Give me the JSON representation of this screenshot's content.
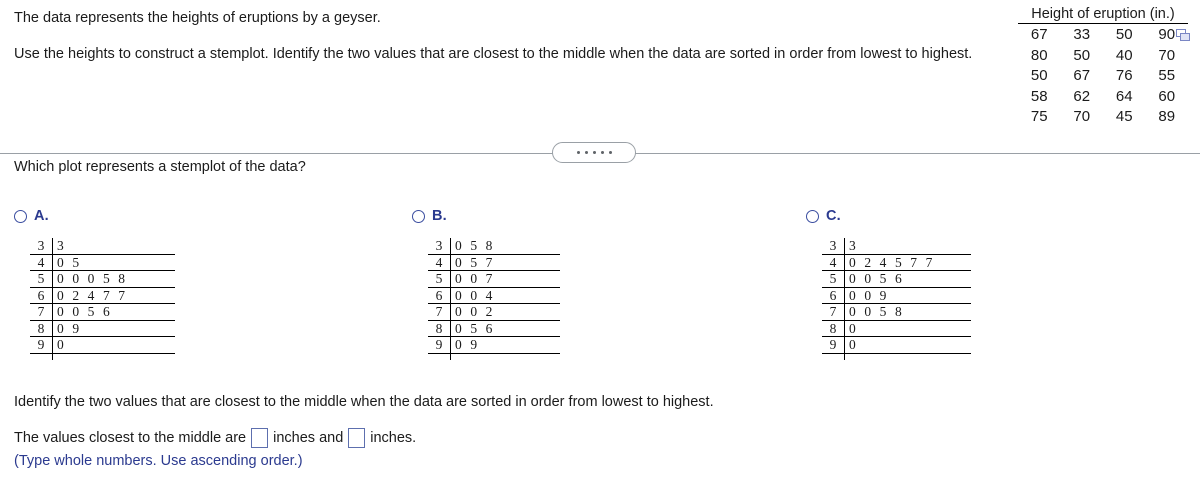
{
  "problem": {
    "intro": "The data represents the heights of eruptions by a geyser.",
    "instruction": "Use the heights to construct a stemplot. Identify the two values that are closest to the middle when the data are sorted in order from lowest to highest.",
    "question": "Which plot represents a stemplot of the data?",
    "identify": "Identify the two values that are closest to the middle when the data are sorted in order from lowest to highest."
  },
  "data_table": {
    "title": "Height of eruption (in.)",
    "rows": [
      [
        "67",
        "33",
        "50",
        "90"
      ],
      [
        "80",
        "50",
        "40",
        "70"
      ],
      [
        "50",
        "67",
        "76",
        "55"
      ],
      [
        "58",
        "62",
        "64",
        "60"
      ],
      [
        "75",
        "70",
        "45",
        "89"
      ]
    ],
    "copy_icon": "copy-icon"
  },
  "divider": {
    "icon": "ellipsis-icon",
    "dots": 5
  },
  "options": [
    {
      "letter": "A.",
      "radio_state": "unselected",
      "rows": [
        {
          "stem": "3",
          "leaves": "3"
        },
        {
          "stem": "4",
          "leaves": "0 5"
        },
        {
          "stem": "5",
          "leaves": "0 0 0 5 8"
        },
        {
          "stem": "6",
          "leaves": "0 2 4 7 7"
        },
        {
          "stem": "7",
          "leaves": "0 0 5 6"
        },
        {
          "stem": "8",
          "leaves": "0 9"
        },
        {
          "stem": "9",
          "leaves": "0"
        }
      ]
    },
    {
      "letter": "B.",
      "radio_state": "unselected",
      "rows": [
        {
          "stem": "3",
          "leaves": "0 5 8"
        },
        {
          "stem": "4",
          "leaves": "0 5 7"
        },
        {
          "stem": "5",
          "leaves": "0 0 7"
        },
        {
          "stem": "6",
          "leaves": "0 0 4"
        },
        {
          "stem": "7",
          "leaves": "0 0 2"
        },
        {
          "stem": "8",
          "leaves": "0 5 6"
        },
        {
          "stem": "9",
          "leaves": "0 9"
        }
      ]
    },
    {
      "letter": "C.",
      "radio_state": "unselected",
      "rows": [
        {
          "stem": "3",
          "leaves": "3"
        },
        {
          "stem": "4",
          "leaves": "0 2 4 5 7 7"
        },
        {
          "stem": "5",
          "leaves": "0 0 5 6"
        },
        {
          "stem": "6",
          "leaves": "0 0 9"
        },
        {
          "stem": "7",
          "leaves": "0 0 5 8"
        },
        {
          "stem": "8",
          "leaves": "0"
        },
        {
          "stem": "9",
          "leaves": "0"
        }
      ]
    }
  ],
  "answer": {
    "prefix": "The values closest to the middle are",
    "middle": "inches and",
    "suffix": "inches.",
    "value_1": "",
    "value_2": "",
    "hint": "(Type whole numbers. Use ascending order.)"
  },
  "colors": {
    "option_blue": "#2b3a8f",
    "hint_blue": "#2b3a8f",
    "input_border": "#5d6fae",
    "rule_gray": "#9aa0a6"
  }
}
